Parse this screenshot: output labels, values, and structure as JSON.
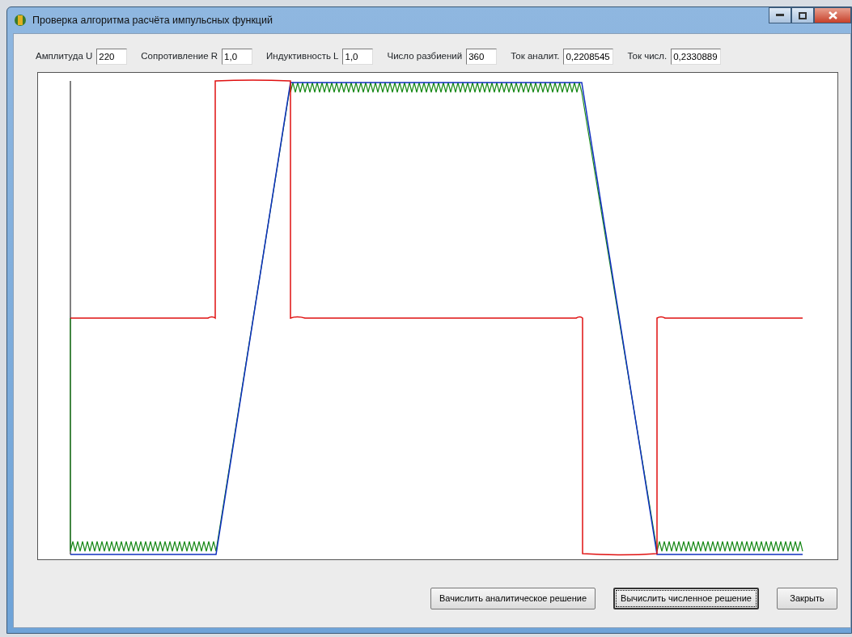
{
  "window": {
    "title": "Проверка алгоритма расчёта импульсных функций"
  },
  "fields": [
    {
      "label": "Амплитуда U",
      "value": "220"
    },
    {
      "label": "Сопротивление  R",
      "value": "1,0"
    },
    {
      "label": "Индуктивность L",
      "value": "1,0"
    },
    {
      "label": "Число разбиений",
      "value": "360"
    },
    {
      "label": "Ток аналит.",
      "value": "0,2208545"
    },
    {
      "label": "Ток числ.",
      "value": "0,2330889"
    }
  ],
  "buttons": [
    {
      "label": "Вачислить аналитическое решение",
      "focused": false
    },
    {
      "label": "Вычислить численное решение",
      "focused": true
    },
    {
      "label": "Закрыть",
      "focused": false
    }
  ]
}
